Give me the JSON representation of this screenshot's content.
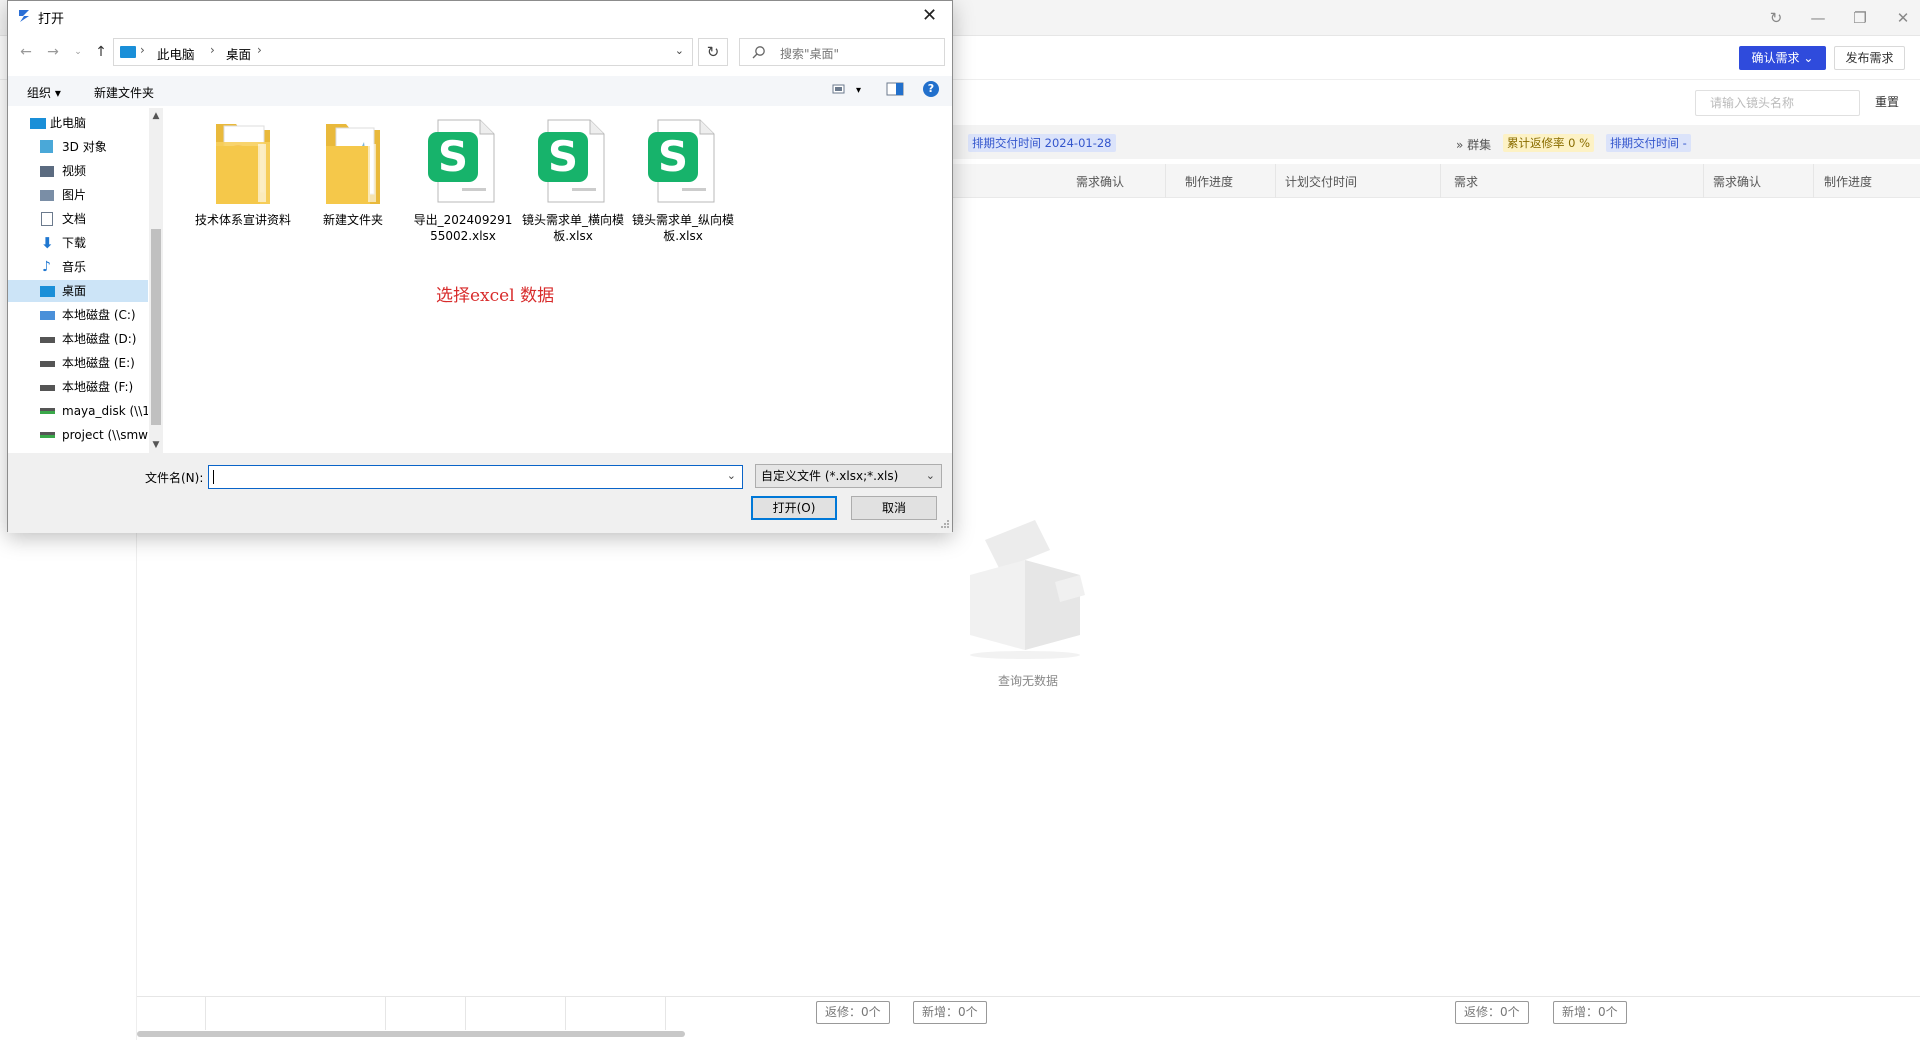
{
  "background_app": {
    "confirm_button": "确认需求",
    "publish_button": "发布需求",
    "shot_search_placeholder": "请输入镜头名称",
    "reset_button": "重置",
    "tags": {
      "schedule_delivery_left": "排期交付时间 2024-01-28",
      "group": "群集",
      "rework_rate": "累计返修率 0 %",
      "schedule_delivery_right": "排期交付时间 -"
    },
    "columns_left": [
      "需求确认",
      "制作进度",
      "计划交付时间"
    ],
    "columns_right": [
      "需求",
      "需求确认",
      "制作进度"
    ],
    "empty_text": "查询无数据",
    "footer": {
      "rework_left": "返修：0个",
      "new_left": "新增：0个",
      "rework_right": "返修：0个",
      "new_right": "新增：0个"
    }
  },
  "dialog": {
    "title": "打开",
    "breadcrumb": [
      "此电脑",
      "桌面"
    ],
    "search_placeholder": "搜索\"桌面\"",
    "toolbar": {
      "organize": "组织",
      "new_folder": "新建文件夹"
    },
    "nav_items": [
      {
        "label": "此电脑",
        "icon": "computer-icon"
      },
      {
        "label": "3D 对象",
        "icon": "3d-objects-icon"
      },
      {
        "label": "视频",
        "icon": "video-icon"
      },
      {
        "label": "图片",
        "icon": "pictures-icon"
      },
      {
        "label": "文档",
        "icon": "documents-icon"
      },
      {
        "label": "下载",
        "icon": "download-icon"
      },
      {
        "label": "音乐",
        "icon": "music-icon"
      },
      {
        "label": "桌面",
        "icon": "desktop-icon",
        "selected": true
      },
      {
        "label": "本地磁盘 (C:)",
        "icon": "drive-c-icon"
      },
      {
        "label": "本地磁盘 (D:)",
        "icon": "drive-icon"
      },
      {
        "label": "本地磁盘 (E:)",
        "icon": "drive-icon"
      },
      {
        "label": "本地磁盘 (F:)",
        "icon": "drive-icon"
      },
      {
        "label": "maya_disk (\\\\1",
        "icon": "network-drive-icon"
      },
      {
        "label": "project (\\\\smw",
        "icon": "network-drive-icon"
      }
    ],
    "files": [
      {
        "name": "技术体系宣讲资料",
        "type": "folder-ppt"
      },
      {
        "name": "新建文件夹",
        "type": "folder"
      },
      {
        "name": "导出_20240929155002.xlsx",
        "type": "xlsx"
      },
      {
        "name": "镜头需求单_横向模板.xlsx",
        "type": "xlsx"
      },
      {
        "name": "镜头需求单_纵向模板.xlsx",
        "type": "xlsx"
      }
    ],
    "file_labels": {
      "f0": "技术体系宣讲资料",
      "f1": "新建文件夹",
      "f2": "导出_20240929155002.xlsx",
      "f3": "镜头需求单_横向模板.xlsx",
      "f4": "镜头需求单_纵向模板.xlsx"
    },
    "hint_annotation": "选择excel 数据",
    "filename_label": "文件名(N):",
    "filename_value": "",
    "file_type_filter": "自定义文件 (*.xlsx;*.xls)",
    "open_button": "打开(O)",
    "cancel_button": "取消"
  }
}
